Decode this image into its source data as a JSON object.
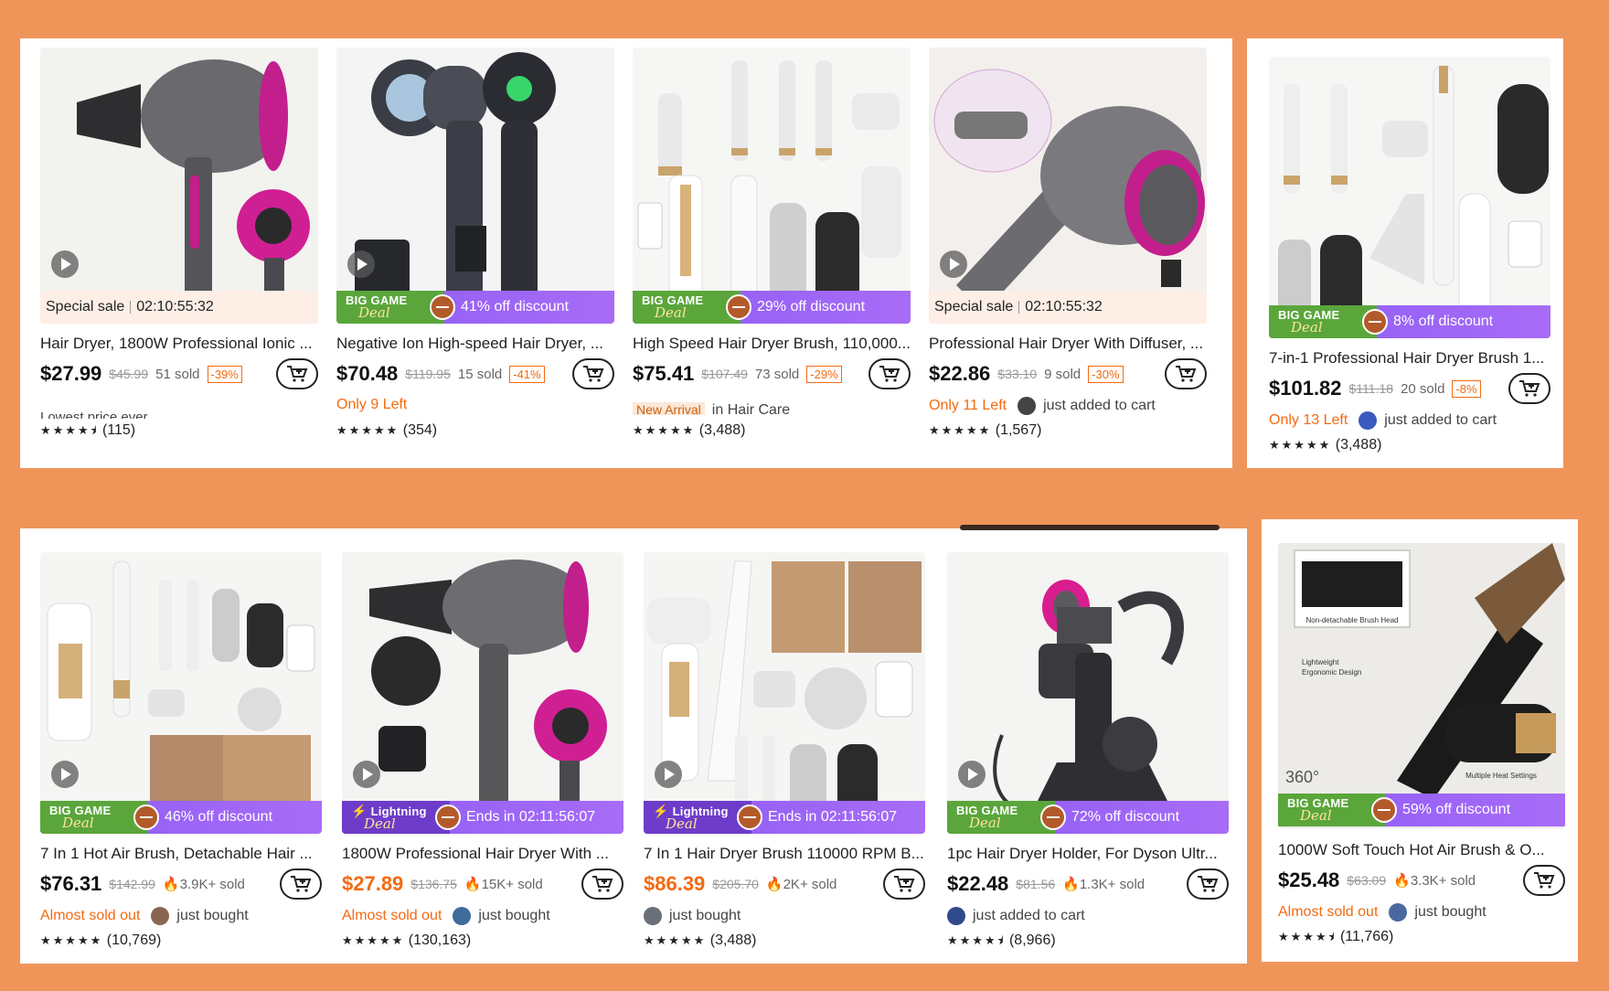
{
  "colors": {
    "accent": "#f36a12",
    "purple": "#9a64f6",
    "background": "#f0955a",
    "green": "#5aa63b"
  },
  "cards": [
    {
      "title": "Hair Dryer, 1800W Professional Ionic ...",
      "price": "$27.99",
      "orig": "$45.99",
      "sold": "51 sold",
      "disc": "-39%",
      "banner_type": "special",
      "banner_text": "Special sale",
      "banner_time": "02:10:55:32",
      "extra": "Lowest price ever",
      "stars": "★★★★⯨",
      "reviews": "(115)"
    },
    {
      "title": "Negative Ion High-speed Hair Dryer, ...",
      "price": "$70.48",
      "orig": "$119.95",
      "sold": "15 sold",
      "disc": "-41%",
      "banner_type": "biggame",
      "tag1": "BIG GAME",
      "tag2": "Deal",
      "banner_text": "41% off discount",
      "stock": "Only 9 Left",
      "stars": "★★★★★",
      "reviews": "(354)"
    },
    {
      "title": "High Speed Hair Dryer Brush, 110,000...",
      "price": "$75.41",
      "orig": "$107.49",
      "sold": "73 sold",
      "disc": "-29%",
      "banner_type": "biggame",
      "tag1": "BIG GAME",
      "tag2": "Deal",
      "banner_text": "29% off discount",
      "new_arrival": "New Arrival",
      "category": "in Hair Care",
      "stars": "★★★★★",
      "reviews": "(3,488)"
    },
    {
      "title": "Professional Hair Dryer With Diffuser, ...",
      "price": "$22.86",
      "orig": "$33.10",
      "sold": "9 sold",
      "disc": "-30%",
      "banner_type": "special",
      "banner_text": "Special sale",
      "banner_time": "02:10:55:32",
      "stock": "Only 11 Left",
      "activity": "just added to cart",
      "stars": "★★★★★",
      "reviews": "(1,567)"
    },
    {
      "title": "7-in-1 Professional Hair Dryer Brush 1...",
      "price": "$101.82",
      "orig": "$111.18",
      "sold": "20 sold",
      "disc": "-8%",
      "banner_type": "biggame",
      "tag1": "BIG GAME",
      "tag2": "Deal",
      "banner_text": "8% off discount",
      "stock": "Only 13 Left",
      "activity": "just added to cart",
      "stars": "★★★★★",
      "reviews": "(3,488)"
    },
    {
      "title": "7 In 1 Hot Air Brush, Detachable Hair ...",
      "price": "$76.31",
      "orig": "$142.99",
      "sold": "3.9K+ sold",
      "banner_type": "biggame",
      "tag1": "BIG GAME",
      "tag2": "Deal",
      "banner_text": "46% off discount",
      "stock": "Almost sold out",
      "activity": "just bought",
      "stars": "★★★★★",
      "reviews": "(10,769)"
    },
    {
      "title": "1800W Professional Hair Dryer With ...",
      "price": "$27.89",
      "orig": "$136.75",
      "sold": "15K+ sold",
      "banner_type": "lightning",
      "tag1": "Lightning",
      "tag2": "Deal",
      "banner_text": "Ends in 02:11:56:07",
      "stock": "Almost sold out",
      "activity": "just bought",
      "stars": "★★★★★",
      "reviews": "(130,163)"
    },
    {
      "title": "7 In 1 Hair Dryer Brush 110000 RPM B...",
      "price": "$86.39",
      "orig": "$205.70",
      "sold": "2K+ sold",
      "banner_type": "lightning",
      "tag1": "Lightning",
      "tag2": "Deal",
      "banner_text": "Ends in 02:11:56:07",
      "activity": "just bought",
      "stars": "★★★★★",
      "reviews": "(3,488)"
    },
    {
      "title": "1pc Hair Dryer Holder, For Dyson Ultr...",
      "price": "$22.48",
      "orig": "$81.56",
      "sold": "1.3K+ sold",
      "banner_type": "biggame",
      "tag1": "BIG GAME",
      "tag2": "Deal",
      "banner_text": "72% off discount",
      "activity": "just added to cart",
      "stars": "★★★★⯨",
      "reviews": "(8,966)"
    },
    {
      "title": "1000W Soft Touch Hot Air Brush & O...",
      "price": "$25.48",
      "orig": "$63.09",
      "sold": "3.3K+ sold",
      "banner_type": "biggame",
      "tag1": "BIG GAME",
      "tag2": "Deal",
      "banner_text": "59% off discount",
      "stock": "Almost sold out",
      "activity": "just bought",
      "stars": "★★★★⯨",
      "reviews": "(11,766)",
      "image_labels": [
        "Non-detachable Brush Head",
        "Lightweight Ergonomic Design",
        "Multiple Heat Settings",
        "360°"
      ]
    }
  ]
}
